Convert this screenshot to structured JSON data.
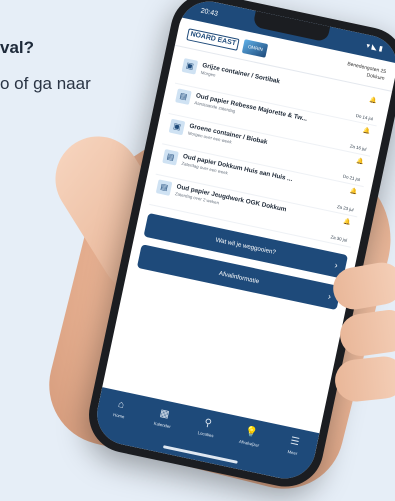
{
  "background_text": {
    "heading": "val?",
    "subtext": "o of ga naar"
  },
  "status_bar": {
    "time": "20:43",
    "icons": "▾ ◣ ▮"
  },
  "header": {
    "logo_text": "NOARD EAST",
    "logo_badge": "OMRIN",
    "address_line1": "Benedengoten 25",
    "address_line2": "Dokkum"
  },
  "collections": [
    {
      "title": "Grijze container / Sortibak",
      "when": "Morgen",
      "date": "Do 14 jul",
      "icon": "grey-bin-icon"
    },
    {
      "title": "Oud papier Rebesse Majorette & Tw...",
      "when": "Aanstaande zaterdag",
      "date": "Za 16 jul",
      "icon": "paper-icon"
    },
    {
      "title": "Groene container / Biobak",
      "when": "Morgen over een week",
      "date": "Do 21 jul",
      "icon": "green-bin-icon"
    },
    {
      "title": "Oud papier Dokkum Huis aan Huis ...",
      "when": "Zaterdag over een week",
      "date": "Za 23 jul",
      "icon": "paper-icon"
    },
    {
      "title": "Oud papier Jeugdwerk OGK Dokkum",
      "when": "Zaterdag over 2 weken",
      "date": "Za 30 jul",
      "icon": "paper-icon"
    }
  ],
  "buttons": {
    "dispose": "Wat wil je weggooien?",
    "news": "Afvalinformatie"
  },
  "tabs": [
    {
      "label": "Home",
      "glyph": "⌂",
      "icon": "home-icon"
    },
    {
      "label": "Kalender",
      "glyph": "▦",
      "icon": "calendar-icon"
    },
    {
      "label": "Locaties",
      "glyph": "⚲",
      "icon": "location-icon"
    },
    {
      "label": "Afvalwijzer",
      "glyph": "💡",
      "icon": "lightbulb-icon"
    },
    {
      "label": "Meer",
      "glyph": "☰",
      "icon": "menu-icon"
    }
  ]
}
